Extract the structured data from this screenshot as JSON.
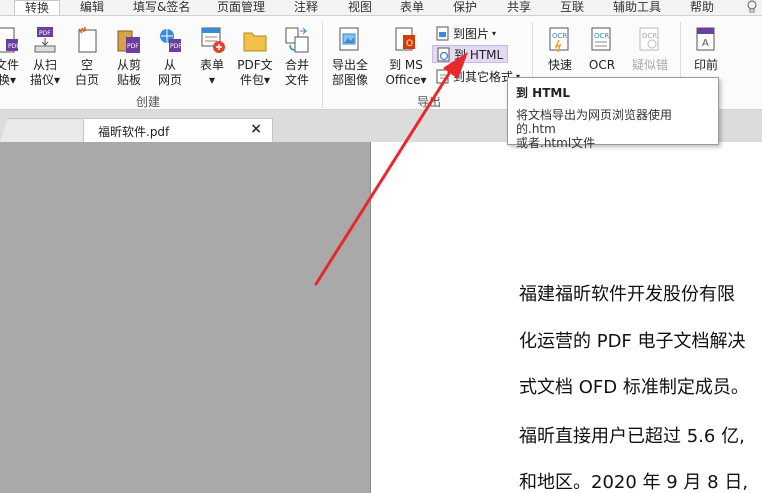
{
  "menu_tabs": [
    "转换",
    "编辑",
    "填写&签名",
    "页面管理",
    "注释",
    "视图",
    "表单",
    "保护",
    "共享",
    "互联",
    "辅助工具",
    "帮助"
  ],
  "active_menu_tab": "转换",
  "ribbon": {
    "create_group": {
      "label": "创建",
      "buttons": [
        {
          "label1": "文件",
          "label2": "换▾"
        },
        {
          "label1": "从扫",
          "label2": "描仪▾"
        },
        {
          "label1": "空",
          "label2": "白页"
        },
        {
          "label1": "从剪",
          "label2": "贴板"
        },
        {
          "label1": "从",
          "label2": "网页"
        },
        {
          "label1": "表单",
          "label2": "▾"
        },
        {
          "label1": "PDF文",
          "label2": "件包▾"
        },
        {
          "label1": "合并",
          "label2": "文件"
        }
      ]
    },
    "export_group": {
      "label": "导出",
      "export_all": {
        "label1": "导出全",
        "label2": "部图像"
      },
      "to_ms_office": {
        "label1": "到 MS",
        "label2": "Office▾"
      },
      "to_image": "到图片",
      "to_html": "到 HTML",
      "to_other": "到其它格式",
      "dropdown_glyph": "▾"
    },
    "ocr_group": {
      "quick": "快速",
      "ocr": "OCR",
      "suspect": "疑似错"
    },
    "print_group": {
      "label": "印前"
    }
  },
  "tooltip": {
    "title": "到 HTML",
    "desc_line1": "将文档导出为网页浏览器使用的.htm",
    "desc_line2": "或者.html文件"
  },
  "document_tab": {
    "name": "福昕软件.pdf",
    "close": "×"
  },
  "page_text": [
    "福建福昕软件开发股份有限",
    "化运营的 PDF 电子文档解决",
    "式文档 OFD 标准制定成员。",
    "福昕直接用户已超过 5.6 亿,",
    "和地区。2020 年 9 月 8 日,"
  ],
  "colors": {
    "arrow": "#e8282b",
    "workspace": "#a9a9a9",
    "highlight": "#e4d9f2"
  }
}
